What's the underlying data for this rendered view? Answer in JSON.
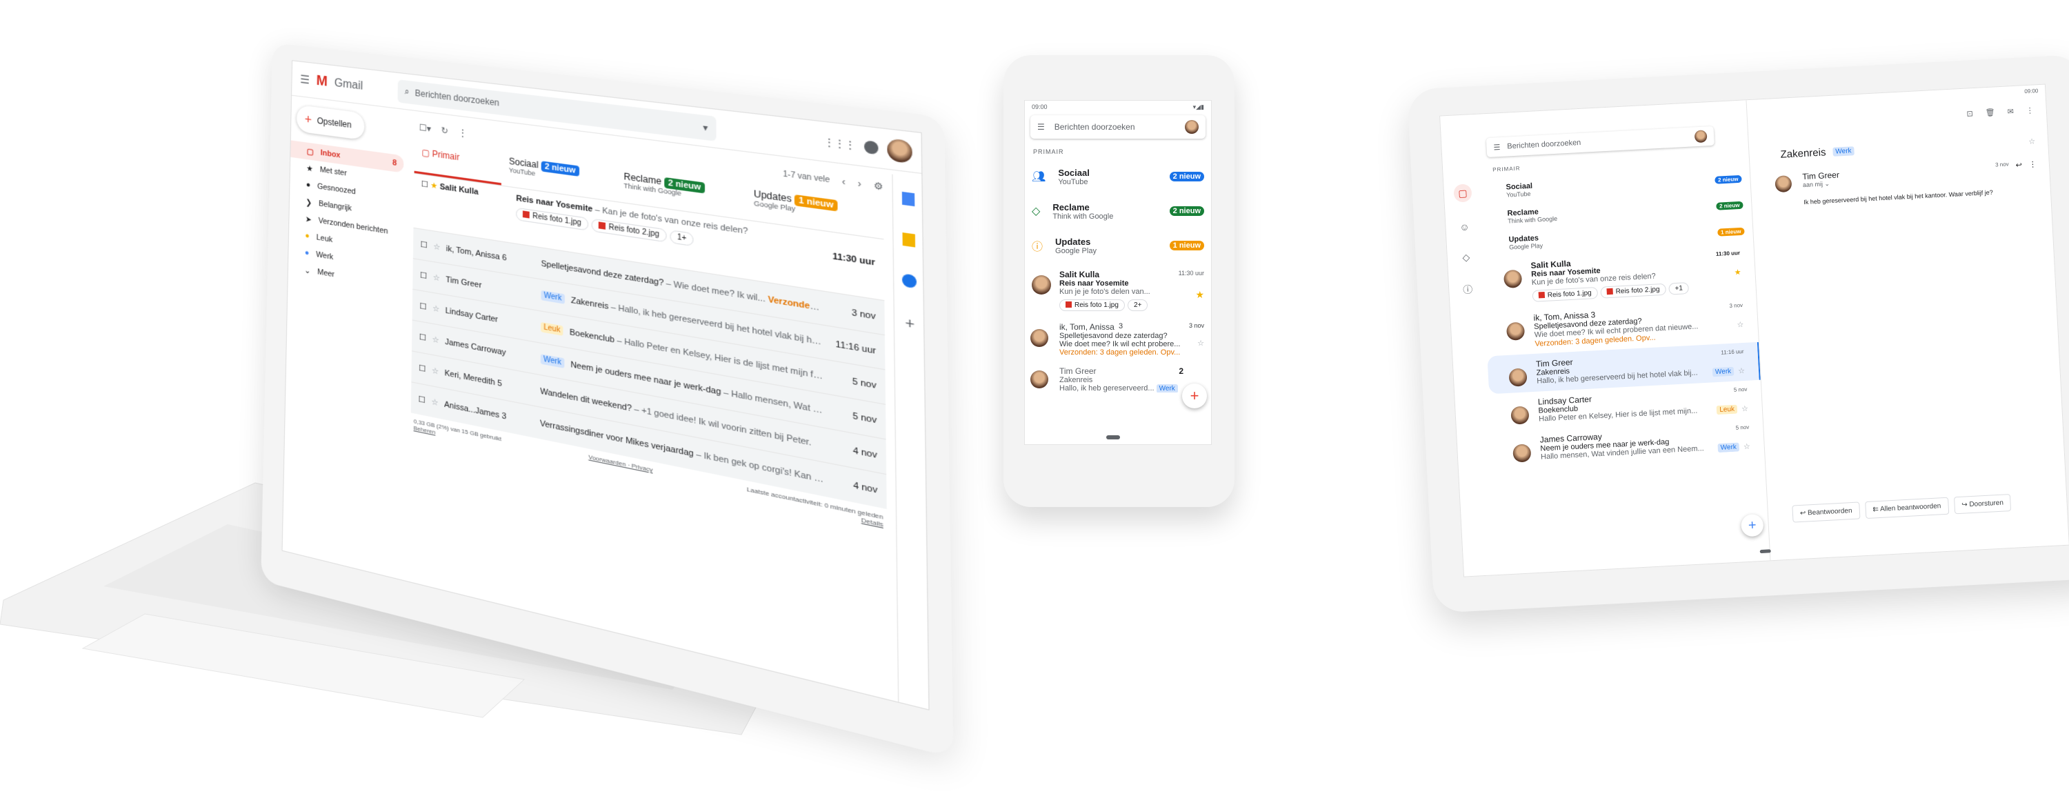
{
  "laptop": {
    "app_name": "Gmail",
    "search_placeholder": "Berichten doorzoeken",
    "compose_label": "Opstellen",
    "sidebar": [
      {
        "label": "Inbox",
        "count": "8",
        "icon": "inbox-icon"
      },
      {
        "label": "Met ster",
        "icon": "star-icon"
      },
      {
        "label": "Gesnoozed",
        "icon": "clock-icon"
      },
      {
        "label": "Belangrijk",
        "icon": "important-icon"
      },
      {
        "label": "Verzonden berichten",
        "icon": "send-icon"
      },
      {
        "label": "Leuk",
        "icon": "label-icon"
      },
      {
        "label": "Werk",
        "icon": "label-icon"
      },
      {
        "label": "Meer",
        "icon": "chevron-down-icon"
      }
    ],
    "pager": "1-7 van vele",
    "tabs": [
      {
        "label": "Primair"
      },
      {
        "label": "Sociaal",
        "badge": "2 nieuw",
        "sub": "YouTube"
      },
      {
        "label": "Reclame",
        "badge": "2 nieuw",
        "sub": "Think with Google"
      },
      {
        "label": "Updates",
        "badge": "1 nieuw",
        "sub": "Google Play"
      }
    ],
    "featured": {
      "from": "Salit Kulla",
      "subject": "Reis naar Yosemite",
      "snippet": " – Kan je de foto's van onze reis delen?",
      "attachments": [
        "Reis foto 1.jpg",
        "Reis foto 2.jpg"
      ],
      "more": "1+",
      "time": "11:30 uur"
    },
    "rows": [
      {
        "from": "ik, Tom, Anissa 6",
        "label": "",
        "subject": "Spelletjesavond deze zaterdag?",
        "snippet": " – Wie doet mee? Ik wil...",
        "followup": "Verzonden: 3 dagen geleden. Opvolgen?",
        "date": "3 nov"
      },
      {
        "from": "Tim Greer",
        "label": "Werk",
        "subject": "Zakenreis",
        "snippet": " – Hallo, ik heb gereserveerd bij het hotel vlak bij het kantoor (Zie...",
        "followup": "",
        "date": "11:16 uur"
      },
      {
        "from": "Lindsay Carter",
        "label": "Leuk",
        "subject": "Boekenclub",
        "snippet": " – Hallo Peter en Kelsey, Hier is de lijst met mijn favoriete boeken...",
        "followup": "",
        "date": "5 nov"
      },
      {
        "from": "James Carroway",
        "label": "Werk",
        "subject": "Neem je ouders mee naar je werk-dag",
        "snippet": " – Hallo mensen, Wat vinden jullie van...",
        "followup": "",
        "date": "5 nov"
      },
      {
        "from": "Keri, Meredith 5",
        "label": "",
        "subject": "Wandelen dit weekend?",
        "snippet": " – +1 goed idee! Ik wil voorin zitten bij Peter.",
        "followup": "",
        "date": "4 nov"
      },
      {
        "from": "Anissa...James 3",
        "label": "",
        "subject": "Verrassingsdiner voor Mikes verjaardag",
        "snippet": " – Ik ben gek op corgi's! Kan niet wachten om...",
        "followup": "",
        "date": "4 nov"
      }
    ],
    "footer": {
      "storage": "0,33 GB (2%) van 15 GB gebruikt",
      "manage": "Beheren",
      "terms": "Voorwaarden · Privacy",
      "activity": "Laatste accountactiviteit: 0 minuten geleden",
      "details": "Details"
    }
  },
  "phone": {
    "time": "09:00",
    "search_placeholder": "Berichten doorzoeken",
    "section": "PRIMAIR",
    "categories": [
      {
        "title": "Sociaal",
        "sub": "YouTube",
        "badge": "2 nieuw",
        "color": "#1a73e8"
      },
      {
        "title": "Reclame",
        "sub": "Think with Google",
        "badge": "2 nieuw",
        "color": "#188038"
      },
      {
        "title": "Updates",
        "sub": "Google Play",
        "badge": "1 nieuw",
        "color": "#f29900"
      }
    ],
    "mail1": {
      "from": "Salit Kulla",
      "subject": "Reis naar Yosemite",
      "snippet": "Kun je je foto's delen van...",
      "time": "11:30 uur",
      "attachment": "Reis foto 1.jpg",
      "more": "2+"
    },
    "mail2": {
      "from": "ik, Tom, Anissa",
      "count": "3",
      "subject": "Spelletjesavond deze zaterdag?",
      "snippet": "Wie doet mee? Ik wil echt probere...",
      "followup": "Verzonden: 3 dagen geleden. Opv...",
      "date": "3 nov"
    },
    "mail3": {
      "from": "Tim Greer",
      "subject": "Zakenreis",
      "snippet": "Hallo, ik heb gereserveerd...",
      "label": "Werk",
      "date": "2"
    }
  },
  "tablet": {
    "time": "09:00",
    "search_placeholder": "Berichten doorzoeken",
    "section": "PRIMAIR",
    "categories": [
      {
        "title": "Sociaal",
        "sub": "YouTube",
        "badge": "2 nieuw"
      },
      {
        "title": "Reclame",
        "sub": "Think with Google",
        "badge": "2 nieuw"
      },
      {
        "title": "Updates",
        "sub": "Google Play",
        "badge": "1 nieuw"
      }
    ],
    "mails": [
      {
        "from": "Salit Kulla",
        "subject": "Reis naar Yosemite",
        "snippet": "Kun je de foto's van onze reis delen?",
        "time": "11:30 uur",
        "attachments": [
          "Reis foto 1.jpg",
          "Reis foto 2.jpg"
        ],
        "more": "+1"
      },
      {
        "from": "ik, Tom, Anissa 3",
        "subject": "Spelletjesavond deze zaterdag?",
        "snippet": "Wie doet mee? Ik wil echt proberen dat nieuwe...",
        "followup": "Verzonden: 3 dagen geleden. Opv...",
        "time": "3 nov"
      },
      {
        "from": "Tim Greer",
        "subject": "Zakenreis",
        "snippet": "Hallo, ik heb gereserveerd bij het hotel vlak bij...",
        "label": "Werk",
        "time": "11:16 uur"
      },
      {
        "from": "Lindsay Carter",
        "subject": "Boekenclub",
        "snippet": "Hallo Peter en Kelsey, Hier is de lijst met mijn...",
        "label": "Leuk",
        "time": "5 nov"
      },
      {
        "from": "James Carroway",
        "subject": "Neem je ouders mee naar je werk-dag",
        "snippet": "Hallo mensen, Wat vinden jullie van een Neem...",
        "label": "Werk",
        "time": "5 nov"
      }
    ],
    "detail": {
      "subject": "Zakenreis",
      "label": "Werk",
      "from": "Tim Greer",
      "to": "aan mij",
      "date": "3 nov",
      "body": "Ik heb gereserveerd bij het hotel vlak bij het kantoor. Waar verblijf je?",
      "reply": "Beantwoorden",
      "reply_all": "Allen beantwoorden",
      "forward": "Doorsturen"
    }
  }
}
